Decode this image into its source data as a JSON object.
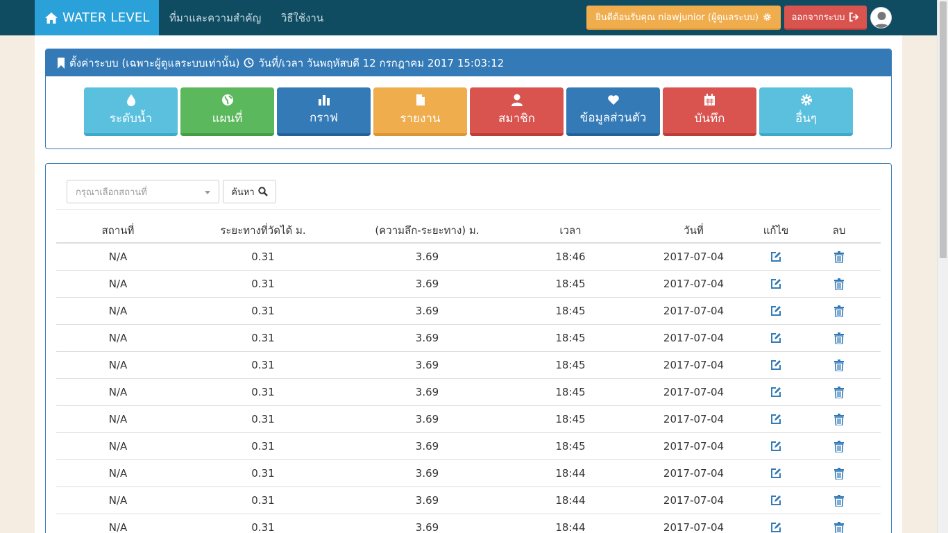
{
  "navbar": {
    "brand": "WATER LEVEL",
    "links": [
      "ที่มาและความสำคัญ",
      "วิธีใช้งาน"
    ],
    "welcome": "ยินดีต้อนรับคุณ niawjunior (ผู้ดูแลระบบ)",
    "logout": "ออกจากระบบ"
  },
  "settings_panel": {
    "title": "ตั้งค่าระบบ (เฉพาะผู้ดูแลระบบเท่านั้น)",
    "datetime": "วันที่/เวลา วันพฤหัสบดี 12 กรกฎาคม 2017 15:03:12",
    "tiles": [
      {
        "label": "ระดับน้ำ",
        "icon": "tint-icon",
        "color": "#5bc0de"
      },
      {
        "label": "แผนที่",
        "icon": "globe-icon",
        "color": "#5cb85c"
      },
      {
        "label": "กราฟ",
        "icon": "bar-chart-icon",
        "color": "#337ab7"
      },
      {
        "label": "รายงาน",
        "icon": "file-icon",
        "color": "#f0ad4e"
      },
      {
        "label": "สมาชิก",
        "icon": "user-icon",
        "color": "#d9534f"
      },
      {
        "label": "ข้อมูลส่วนตัว",
        "icon": "heart-icon",
        "color": "#337ab7"
      },
      {
        "label": "บันทึก",
        "icon": "calendar-icon",
        "color": "#d9534f"
      },
      {
        "label": "อื่นๆ",
        "icon": "gear-icon",
        "color": "#5bc0de"
      }
    ]
  },
  "filter": {
    "placeholder": "กรุณาเลือกสถานที่",
    "search_label": "ค้นหา"
  },
  "table": {
    "headers": [
      "สถานที่",
      "ระยะทางที่วัดได้ ม.",
      "(ความลึก-ระยะทาง) ม.",
      "เวลา",
      "วันที่",
      "แก้ไข",
      "ลบ"
    ],
    "rows": [
      [
        "N/A",
        "0.31",
        "3.69",
        "18:46",
        "2017-07-04"
      ],
      [
        "N/A",
        "0.31",
        "3.69",
        "18:45",
        "2017-07-04"
      ],
      [
        "N/A",
        "0.31",
        "3.69",
        "18:45",
        "2017-07-04"
      ],
      [
        "N/A",
        "0.31",
        "3.69",
        "18:45",
        "2017-07-04"
      ],
      [
        "N/A",
        "0.31",
        "3.69",
        "18:45",
        "2017-07-04"
      ],
      [
        "N/A",
        "0.31",
        "3.69",
        "18:45",
        "2017-07-04"
      ],
      [
        "N/A",
        "0.31",
        "3.69",
        "18:45",
        "2017-07-04"
      ],
      [
        "N/A",
        "0.31",
        "3.69",
        "18:45",
        "2017-07-04"
      ],
      [
        "N/A",
        "0.31",
        "3.69",
        "18:44",
        "2017-07-04"
      ],
      [
        "N/A",
        "0.31",
        "3.69",
        "18:44",
        "2017-07-04"
      ],
      [
        "N/A",
        "0.31",
        "3.69",
        "18:44",
        "2017-07-04"
      ]
    ]
  },
  "colors": {
    "navbar": "#0f4c62",
    "brand": "#2aa1d8",
    "primary": "#337ab7",
    "warning": "#f0ad4e",
    "danger": "#d9534f"
  }
}
